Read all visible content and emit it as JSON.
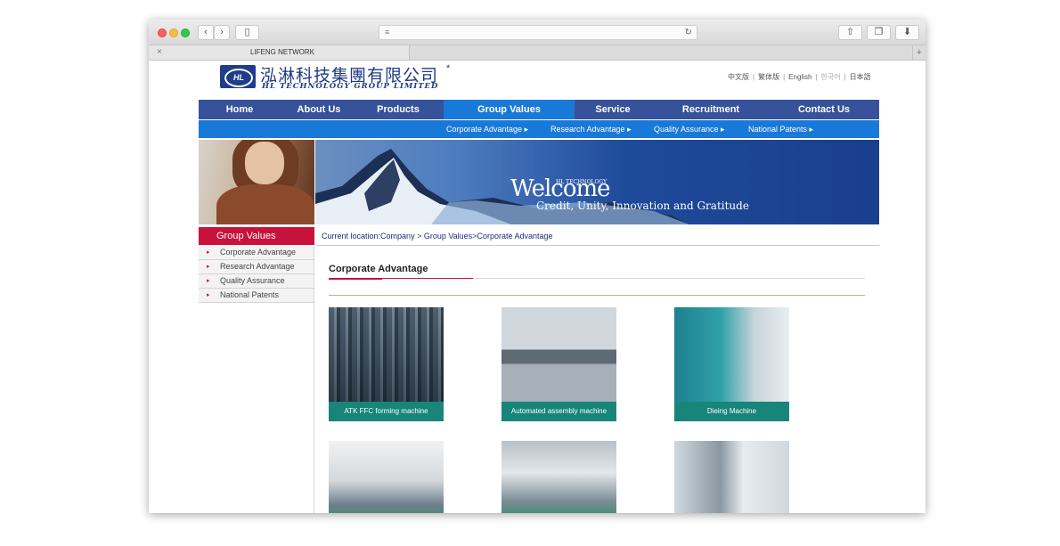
{
  "browser": {
    "tab_title": "LIFENG NETWORK",
    "tab_close": "×",
    "tab_new": "+"
  },
  "header": {
    "logo_mark": "HL",
    "logo_cn": "泓淋科技集團有限公司",
    "logo_star": "*",
    "logo_en": "HL TECHNOLOGY GROUP LIMITED",
    "languages": [
      "中文版",
      "繁体版",
      "English",
      "한국어",
      "日本語"
    ]
  },
  "nav": {
    "items": [
      "Home",
      "About Us",
      "Products",
      "Group Values",
      "Service",
      "Recruitment",
      "Contact Us"
    ],
    "active": "Group Values",
    "sub_items": [
      "Corporate Advantage",
      "Research Advantage",
      "Quality Assurance",
      "National Patents"
    ]
  },
  "banner": {
    "welcome": "Welcome",
    "hl_technology": "HL TECHNOLOGY",
    "tagline": "Credit, Unity, Innovation and Gratitude"
  },
  "sidebar": {
    "heading": "Group Values",
    "items": [
      "Corporate Advantage",
      "Research Advantage",
      "Quality Assurance",
      "National Patents"
    ]
  },
  "breadcrumb": {
    "label": "Current location:",
    "path": "Company > Group Values>Corporate Advantage"
  },
  "content": {
    "title": "Corporate Advantage",
    "cards": [
      {
        "caption": "ATK FFC forming machine"
      },
      {
        "caption": "Automated assembly machine"
      },
      {
        "caption": "Dieing Machine"
      }
    ]
  },
  "colors": {
    "nav_bg": "#36529a",
    "nav_active": "#1979d8",
    "accent_red": "#c8123c",
    "caption_teal": "#17857a"
  }
}
